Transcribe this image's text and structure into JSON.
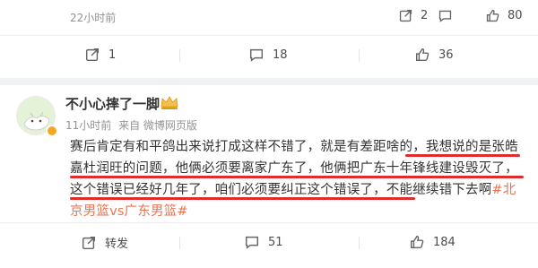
{
  "post_top": {
    "time": "22小时前",
    "share_count": "2",
    "like_count": "80",
    "actions": {
      "repost_count": "1",
      "comment_count": "18",
      "like_count": "36"
    }
  },
  "post_main": {
    "username": "不小心摔了一脚",
    "time": "11小时前",
    "source": "来自 微博网页版",
    "text_part1": "赛后肯定有和平鸽出来说打成这样不错了，就是有差距啥的，我想说的是张皓嘉杜润旺的问题，他俩必须要离家广东了，他俩把广东十年锋线建设毁灭了，这个错误已经好几年了，咱们必须要纠正这个错误了，不能继续错下去啊",
    "hashtag": "#北京男篮vs广东男篮#",
    "actions": {
      "repost_label": "转发",
      "comment_count": "51",
      "like_count": "184"
    }
  },
  "colors": {
    "accent_link": "#eb7350",
    "underline": "#e02c2c",
    "icon_grey": "#4d4d4d",
    "meta_grey": "#939393"
  }
}
